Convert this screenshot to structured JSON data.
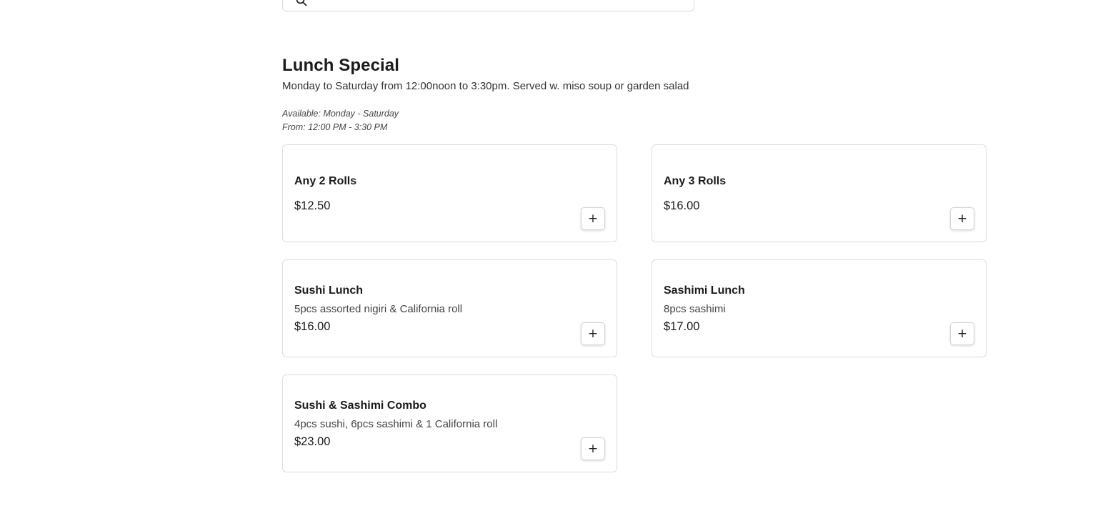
{
  "search": {
    "placeholder": ""
  },
  "section": {
    "title": "Lunch Special",
    "description": "Monday to Saturday from 12:00noon to 3:30pm. Served w. miso soup or garden salad",
    "available_days": "Available: Monday - Saturday",
    "available_hours": "From: 12:00 PM - 3:30 PM"
  },
  "items": [
    {
      "name": "Any 2 Rolls",
      "description": "",
      "price": "$12.50",
      "add_label": "+"
    },
    {
      "name": "Any 3 Rolls",
      "description": "",
      "price": "$16.00",
      "add_label": "+"
    },
    {
      "name": "Sushi Lunch",
      "description": "5pcs assorted nigiri & California roll",
      "price": "$16.00",
      "add_label": "+"
    },
    {
      "name": "Sashimi Lunch",
      "description": "8pcs sashimi",
      "price": "$17.00",
      "add_label": "+"
    },
    {
      "name": "Sushi & Sashimi Combo",
      "description": "4pcs sushi, 6pcs sashimi & 1 California roll",
      "price": "$23.00",
      "add_label": "+"
    }
  ]
}
